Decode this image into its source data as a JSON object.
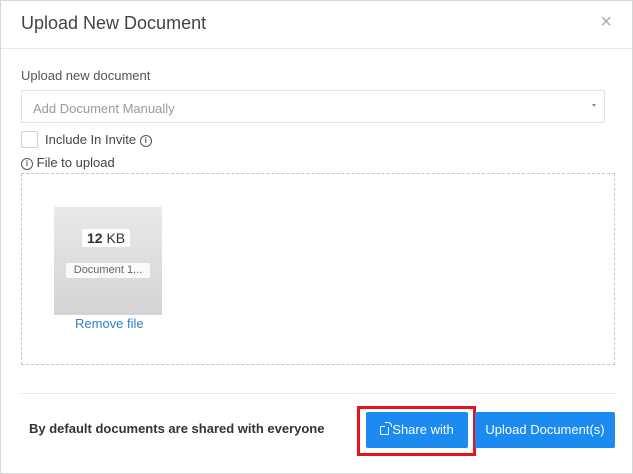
{
  "modal": {
    "title": "Upload New Document",
    "close_glyph": "×"
  },
  "form": {
    "upload_label": "Upload new document",
    "select_value": "Add Document Manually",
    "include_label": "Include In Invite",
    "include_checked": false,
    "file_label": "File to upload",
    "info_glyph": "i"
  },
  "file": {
    "size_value": "12",
    "size_unit": "KB",
    "name": "Document 1...",
    "remove_label": "Remove file"
  },
  "footer": {
    "note": "By default documents are shared with everyone",
    "share_label": "Share with",
    "upload_label": "Upload Document(s)"
  },
  "colors": {
    "primary": "#1b8af1",
    "link": "#2f80c9",
    "highlight": "#e8141c"
  },
  "icons": {
    "close": "close-icon",
    "info": "info-icon",
    "share": "share-icon",
    "caret": "chevron-down-icon"
  }
}
